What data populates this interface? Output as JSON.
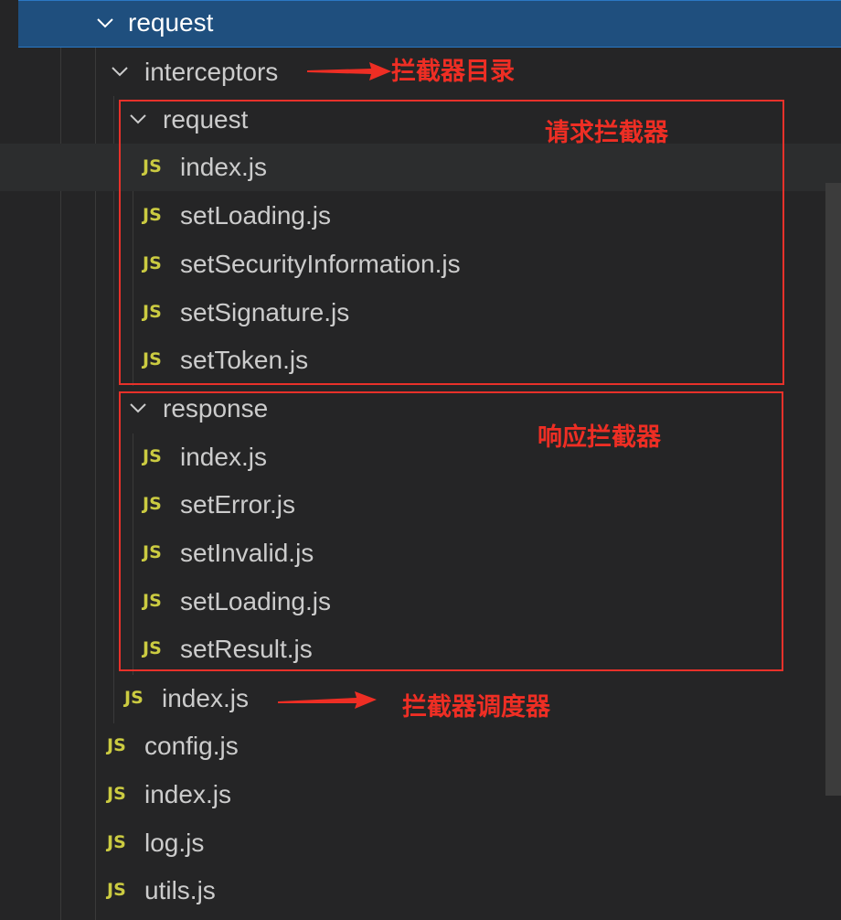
{
  "tree": {
    "root_folder": "request",
    "interceptors_folder": "interceptors",
    "request_folder": "request",
    "request_files": [
      "index.js",
      "setLoading.js",
      "setSecurityInformation.js",
      "setSignature.js",
      "setToken.js"
    ],
    "response_folder": "response",
    "response_files": [
      "index.js",
      "setError.js",
      "setInvalid.js",
      "setLoading.js",
      "setResult.js"
    ],
    "interceptors_index": "index.js",
    "root_files": [
      "config.js",
      "index.js",
      "log.js",
      "utils.js"
    ],
    "js_badge": "JS"
  },
  "annotations": {
    "interceptors_dir": "拦截器目录",
    "request_interceptor": "请求拦截器",
    "response_interceptor": "响应拦截器",
    "dispatcher": "拦截器调度器"
  },
  "colors": {
    "background": "#252526",
    "selection": "#1f4f7e",
    "js_icon": "#cbcb41",
    "annotation_red": "#ee2e24"
  }
}
